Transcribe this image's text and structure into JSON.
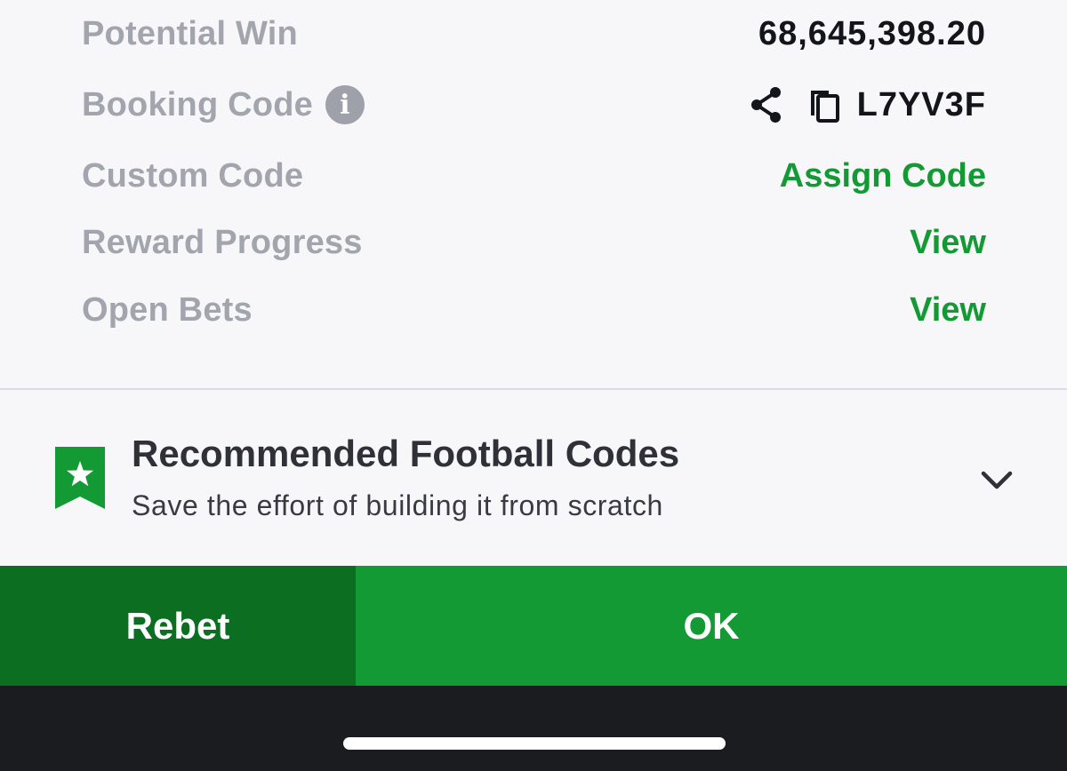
{
  "summary": {
    "potential_win": {
      "label": "Potential Win",
      "value": "68,645,398.20"
    },
    "booking_code": {
      "label": "Booking Code",
      "info_icon": "i",
      "value": "L7YV3F",
      "share_icon": "share-icon",
      "copy_icon": "copy-icon"
    },
    "custom_code": {
      "label": "Custom Code",
      "action": "Assign Code"
    },
    "reward_progress": {
      "label": "Reward Progress",
      "action": "View"
    },
    "open_bets": {
      "label": "Open Bets",
      "action": "View"
    }
  },
  "recommend": {
    "title": "Recommended Football Codes",
    "subtitle": "Save the effort of building it from scratch",
    "icon": "bookmark-star-icon",
    "expand_icon": "chevron-down-icon"
  },
  "actions": {
    "rebet_label": "Rebet",
    "ok_label": "OK"
  },
  "colors": {
    "accent_green": "#139a34",
    "dark_green": "#0b6e21",
    "label_gray": "#a2a5ad",
    "value_black": "#14151a",
    "background": "#f7f7f9",
    "bottom_bar": "#1b1c20"
  }
}
